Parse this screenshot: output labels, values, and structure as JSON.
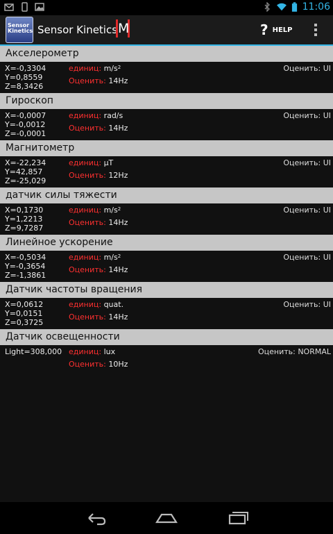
{
  "status_bar": {
    "time": "11:06"
  },
  "app": {
    "icon_text_1": "Sensor",
    "icon_text_2": "Kinetics",
    "title": "Sensor Kinetics",
    "logo_letter": "M",
    "help_label": "HELP"
  },
  "sensors": [
    {
      "name": "Акселерометр",
      "readings": [
        "X=-0,3304",
        "Y=0,8559",
        "Z=8,3426"
      ],
      "unit_label": "единиц:",
      "unit": "m/s",
      "unit_sup": "2",
      "rate_label": "Оценить:",
      "rate": "14Hz",
      "estimate": "Оценить: UI"
    },
    {
      "name": "Гироскоп",
      "readings": [
        "X=-0,0007",
        "Y=-0,0012",
        "Z=-0,0001"
      ],
      "unit_label": "единиц:",
      "unit": "rad/s",
      "unit_sup": "",
      "rate_label": "Оценить:",
      "rate": "14Hz",
      "estimate": "Оценить: UI"
    },
    {
      "name": "Магнитометр",
      "readings": [
        "X=-22,234",
        "Y=42,857",
        "Z=-25,029"
      ],
      "unit_label": "единиц:",
      "unit": "µT",
      "unit_sup": "",
      "rate_label": "Оценить:",
      "rate": "12Hz",
      "estimate": "Оценить: UI"
    },
    {
      "name": "датчик силы тяжести",
      "readings": [
        "X=0,1730",
        "Y=1,2213",
        "Z=9,7287"
      ],
      "unit_label": "единиц:",
      "unit": "m/s",
      "unit_sup": "2",
      "rate_label": "Оценить:",
      "rate": "14Hz",
      "estimate": "Оценить: UI"
    },
    {
      "name": "Линейное ускорение",
      "readings": [
        "X=-0,5034",
        "Y=-0,3654",
        "Z=-1,3861"
      ],
      "unit_label": "единиц:",
      "unit": "m/s",
      "unit_sup": "2",
      "rate_label": "Оценить:",
      "rate": "14Hz",
      "estimate": "Оценить: UI"
    },
    {
      "name": "Датчик частоты вращения",
      "readings": [
        "X=0,0612",
        "Y=0,0151",
        "Z=0,3725"
      ],
      "unit_label": "единиц:",
      "unit": "quat.",
      "unit_sup": "",
      "rate_label": "Оценить:",
      "rate": "14Hz",
      "estimate": "Оценить: UI"
    },
    {
      "name": "Датчик освещенности",
      "readings": [
        "Light=308,000"
      ],
      "unit_label": "единиц:",
      "unit": "lux",
      "unit_sup": "",
      "rate_label": "Оценить:",
      "rate": "10Hz",
      "estimate": "Оценить: NORMAL"
    }
  ],
  "colors": {
    "accent": "#33b5e5",
    "label_red": "#ff3030",
    "header_bg": "#c6c6c6"
  }
}
